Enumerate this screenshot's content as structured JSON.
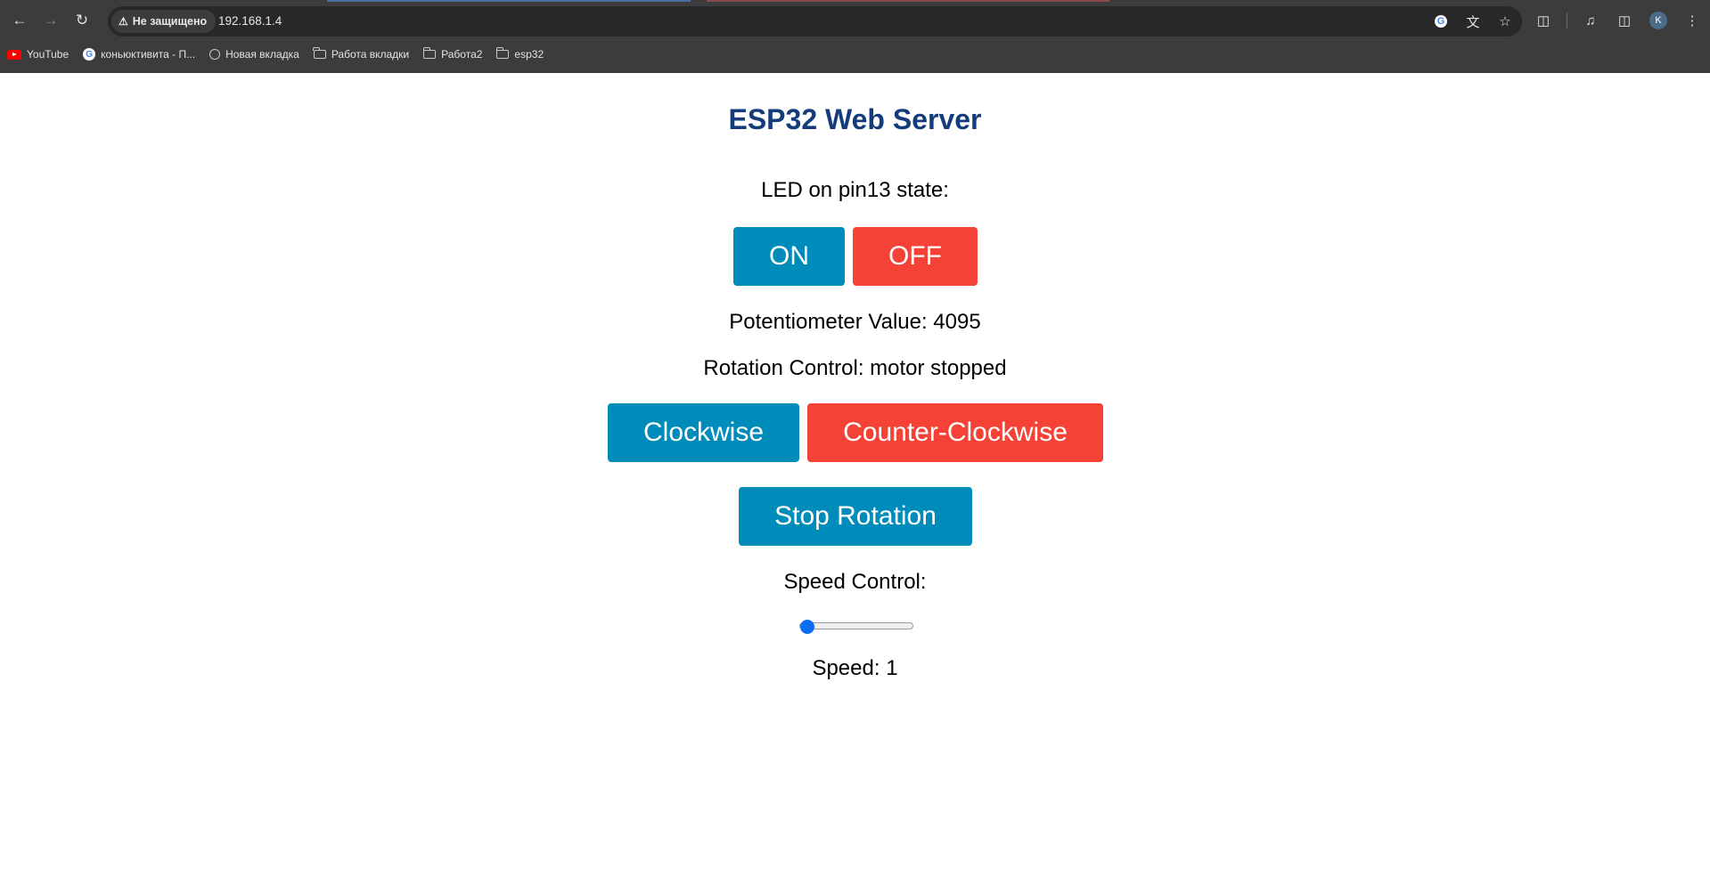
{
  "browser": {
    "security_label": "Не защищено",
    "url": "192.168.1.4",
    "profile_initial": "K",
    "bookmarks": [
      {
        "label": "YouTube",
        "icon": "youtube-icon"
      },
      {
        "label": "коньюктивита - П...",
        "icon": "google-icon"
      },
      {
        "label": "Новая вкладка",
        "icon": "globe-icon"
      },
      {
        "label": "Работа вкладки",
        "icon": "folder-icon"
      },
      {
        "label": "Работа2",
        "icon": "folder-icon"
      },
      {
        "label": "esp32",
        "icon": "folder-icon"
      }
    ]
  },
  "page": {
    "title": "ESP32 Web Server",
    "led_label": "LED on pin13 state:",
    "on_label": "ON",
    "off_label": "OFF",
    "potentiometer_text": "Potentiometer Value: 4095",
    "rotation_text": "Rotation Control: motor stopped",
    "clockwise_label": "Clockwise",
    "counter_clockwise_label": "Counter-Clockwise",
    "stop_label": "Stop Rotation",
    "speed_control_label": "Speed Control:",
    "speed_text": "Speed: 1",
    "speed_slider_fraction": 0
  },
  "colors": {
    "title": "#143c7a",
    "button_blue": "#008cba",
    "button_red": "#f44336",
    "slider_accent": "#0b6ef2"
  }
}
